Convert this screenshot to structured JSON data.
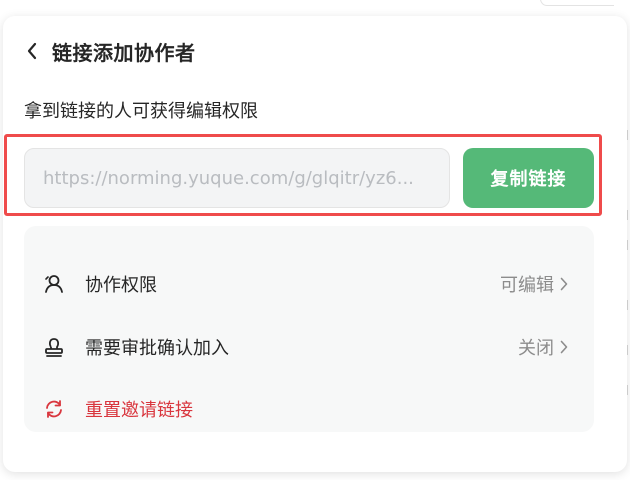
{
  "header": {
    "title": "链接添加协作者"
  },
  "description": "拿到链接的人可获得编辑权限",
  "link": {
    "value": "https://norming.yuque.com/g/glqitr/yz6..."
  },
  "copy_button": "复制链接",
  "settings": {
    "permission": {
      "label": "协作权限",
      "value": "可编辑"
    },
    "approval": {
      "label": "需要审批确认加入",
      "value": "关闭"
    },
    "reset": {
      "label": "重置邀请链接"
    }
  },
  "colors": {
    "accent": "#55b978",
    "highlight": "#ef4b4b",
    "danger": "#d9363e"
  },
  "icons": {
    "back": "chevron-left-icon",
    "permission": "user-icon",
    "approval": "stamp-icon",
    "reset": "refresh-icon",
    "chevron": "chevron-right-icon"
  }
}
